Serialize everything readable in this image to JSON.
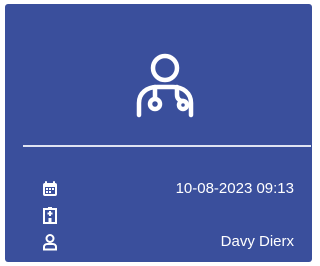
{
  "card": {
    "background_color": "#3a4f9c",
    "header_icon": "doctor-stethoscope-icon",
    "details": {
      "datetime": "10-08-2023 09:13",
      "datetime_icon": "calendar-icon",
      "location": "",
      "location_icon": "hospital-building-icon",
      "user": "Davy Dierx",
      "user_icon": "user-icon"
    }
  }
}
